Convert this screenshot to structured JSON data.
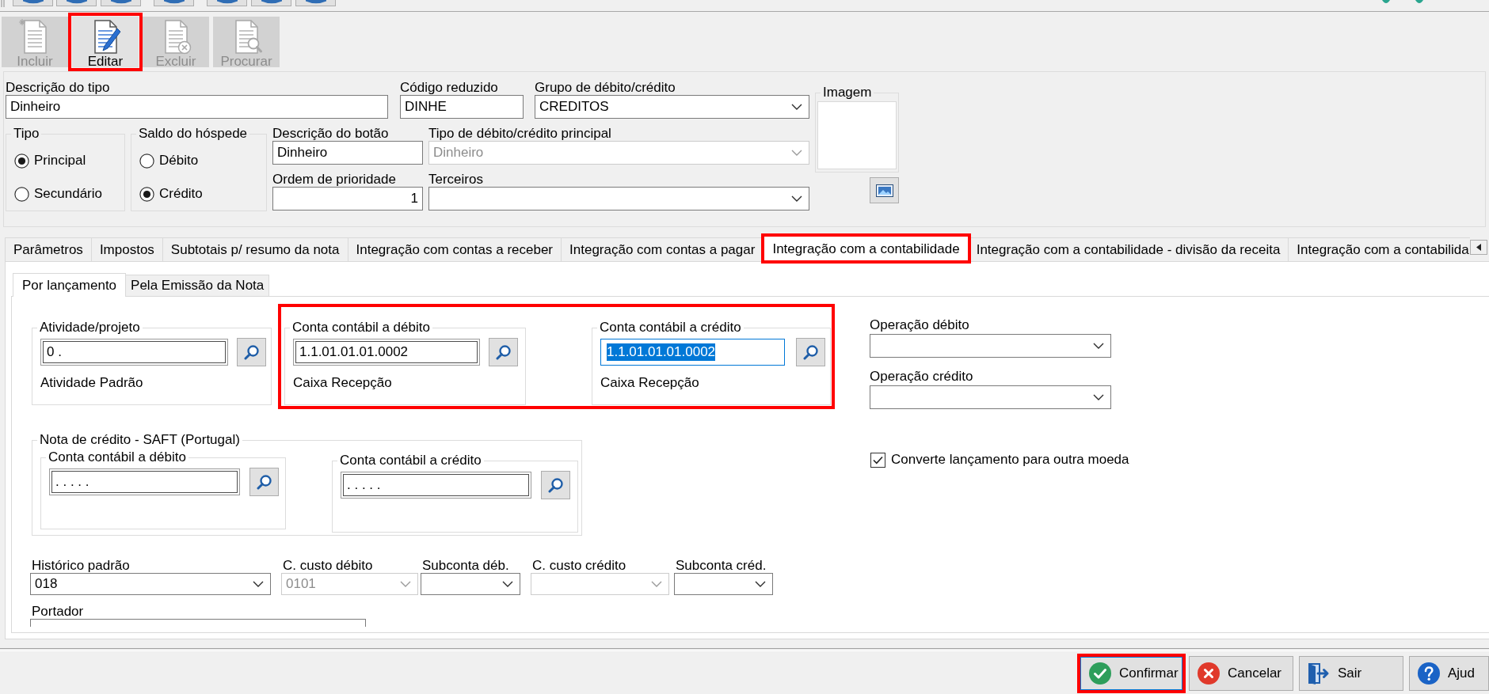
{
  "toolbar": {
    "buttons": [
      {
        "kind": "new",
        "label": "Incluir",
        "disabled": true,
        "highlighted": false
      },
      {
        "kind": "edit",
        "label": "Editar",
        "disabled": false,
        "highlighted": true
      },
      {
        "kind": "delete",
        "label": "Excluir",
        "disabled": true,
        "highlighted": false
      },
      {
        "kind": "find",
        "label": "Procurar",
        "disabled": true,
        "highlighted": false
      }
    ]
  },
  "header": {
    "descricao_tipo": {
      "label": "Descrição do tipo",
      "value": "Dinheiro"
    },
    "codigo_reduzido": {
      "label": "Código reduzido",
      "value": "DINHE"
    },
    "grupo": {
      "label": "Grupo de débito/crédito",
      "value": "CREDITOS"
    },
    "imagem": {
      "label": "Imagem"
    },
    "tipo": {
      "label": "Tipo",
      "options": [
        {
          "label": "Principal",
          "selected": true
        },
        {
          "label": "Secundário",
          "selected": false
        }
      ]
    },
    "saldo_hospede": {
      "label": "Saldo do hóspede",
      "options": [
        {
          "label": "Débito",
          "selected": false
        },
        {
          "label": "Crédito",
          "selected": true
        }
      ]
    },
    "descricao_botao": {
      "label": "Descrição do botão",
      "value": "Dinheiro"
    },
    "tipo_principal": {
      "label": "Tipo de débito/crédito principal",
      "value": "Dinheiro",
      "disabled": true
    },
    "ordem_prioridade": {
      "label": "Ordem de prioridade",
      "value": "1"
    },
    "terceiros": {
      "label": "Terceiros"
    }
  },
  "tabs": [
    {
      "label": "Parâmetros",
      "selected": false,
      "highlighted": false
    },
    {
      "label": "Impostos",
      "selected": false,
      "highlighted": false
    },
    {
      "label": "Subtotais p/ resumo da nota",
      "selected": false,
      "highlighted": false
    },
    {
      "label": "Integração com contas a receber",
      "selected": false,
      "highlighted": false
    },
    {
      "label": "Integração com contas a pagar",
      "selected": false,
      "highlighted": false
    },
    {
      "label": "Integração com a contabilidade",
      "selected": true,
      "highlighted": true
    },
    {
      "label": "Integração com a contabilidade - divisão da receita",
      "selected": false,
      "highlighted": false
    },
    {
      "label": "Integração com a contabilida",
      "selected": false,
      "highlighted": false
    }
  ],
  "subtabs": [
    {
      "label": "Por lançamento",
      "selected": true
    },
    {
      "label": "Pela Emissão da Nota",
      "selected": false
    }
  ],
  "tab_content": {
    "atividade": {
      "label": "Atividade/projeto",
      "value": "0 .",
      "description": "Atividade Padrão"
    },
    "contas": {
      "highlighted": true,
      "items": [
        {
          "label": "Conta contábil a débito",
          "value": "1.1.01.01.01.0002",
          "description": "Caixa Recepção",
          "focused": false
        },
        {
          "label": "Conta contábil a crédito",
          "value": "1.1.01.01.01.0002",
          "description": "Caixa Recepção",
          "focused": true
        }
      ]
    },
    "operacoes": [
      {
        "label": "Operação débito"
      },
      {
        "label": "Operação crédito"
      }
    ],
    "converte": {
      "label": "Converte lançamento para outra moeda",
      "checked": true
    },
    "nota_credito": {
      "title": "Nota de crédito - SAFT (Portugal)",
      "items": [
        {
          "label": "Conta contábil a débito",
          "value": ". . . . ."
        },
        {
          "label": "Conta contábil a crédito",
          "value": ". . . . ."
        }
      ]
    },
    "bottom_fields": [
      {
        "label": "Histórico padrão",
        "value": "018",
        "disabled": false
      },
      {
        "label": "C. custo débito",
        "value": "0101",
        "disabled": true
      },
      {
        "label": "Subconta déb.",
        "disabled": false
      },
      {
        "label": "C. custo crédito",
        "disabled": true
      },
      {
        "label": "Subconta créd.",
        "disabled": false
      }
    ],
    "portador": {
      "label": "Portador"
    }
  },
  "footer": {
    "buttons": [
      {
        "kind": "confirm",
        "label": "Confirmar",
        "highlighted": true,
        "focused": true
      },
      {
        "kind": "cancel",
        "label": "Cancelar",
        "highlighted": false,
        "focused": false
      },
      {
        "kind": "exit",
        "label": "Sair",
        "highlighted": false,
        "focused": false
      },
      {
        "kind": "help",
        "label": "Ajud",
        "highlighted": false,
        "focused": false
      }
    ]
  }
}
